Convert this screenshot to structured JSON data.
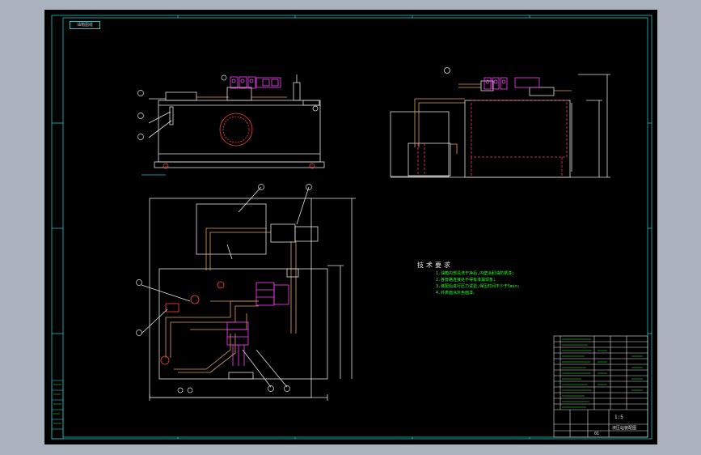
{
  "sheet": {
    "corner_tag": "油箱图纸",
    "colors": {
      "frame": "#21c6c6",
      "outline": "#e0e0e0",
      "pipe": "#e0a060",
      "valve": "#ff40ff",
      "dashed": "#ff3080",
      "note": "#30ff30",
      "background": "#000000",
      "viewport": "#a9b2bd"
    }
  },
  "technical_requirements": {
    "title": "技术要求",
    "lines": [
      "1.油箱内部清洗干净后,内壁涂耐油防锈漆;",
      "2.各管路连接处不得有渗漏现象;",
      "3.装配后进行压力试验,保压时间不少于5min;",
      "4.外表面涂灰色面漆。"
    ]
  },
  "title_block": {
    "scale_label": "1:5",
    "drawing_name": "液压站装配图",
    "sheet_no": "01"
  }
}
